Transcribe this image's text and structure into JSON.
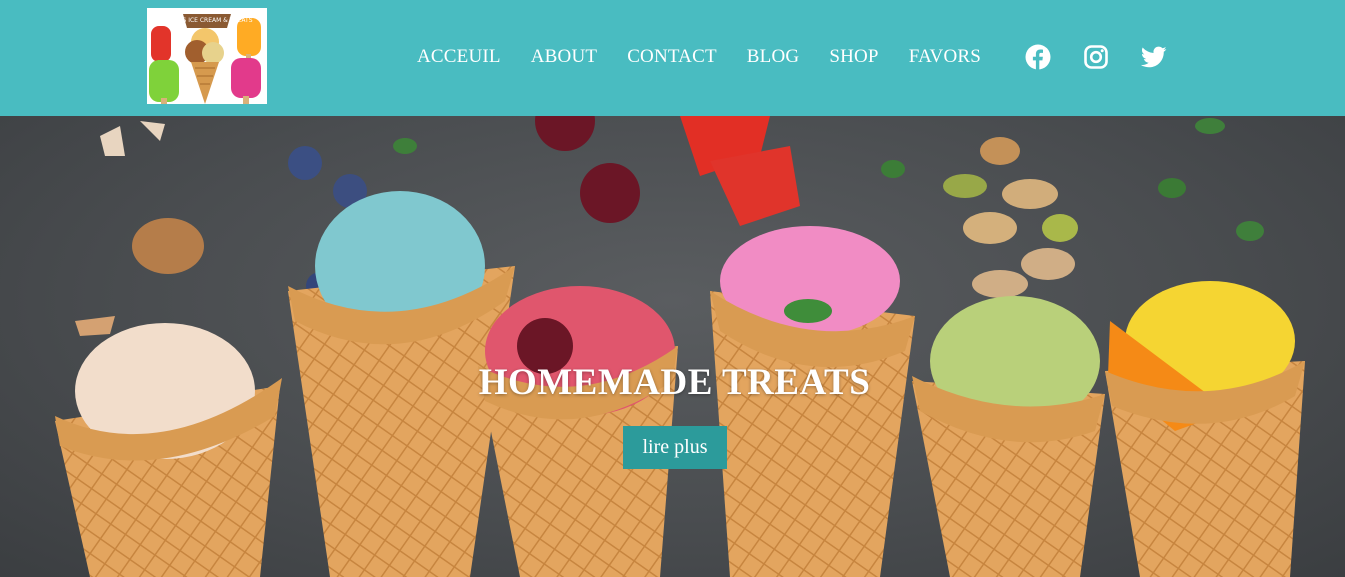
{
  "brand": {
    "logo_text": "SWEETS ICE CREAM & TREATS"
  },
  "nav": {
    "items": [
      {
        "label": "ACCEUIL"
      },
      {
        "label": "ABOUT"
      },
      {
        "label": "CONTACT"
      },
      {
        "label": "BLOG"
      },
      {
        "label": "SHOP"
      },
      {
        "label": "FAVORS"
      }
    ]
  },
  "socials": {
    "items": [
      {
        "icon": "facebook-icon"
      },
      {
        "icon": "instagram-icon"
      },
      {
        "icon": "twitter-icon"
      }
    ]
  },
  "hero": {
    "title": "HOMEMADE TREATS",
    "button_label": "lire plus",
    "image": "ice-cream-cones-photo"
  },
  "colors": {
    "header_bg": "#49bcc1",
    "button_bg": "#2c9b9b",
    "text": "#ffffff"
  }
}
